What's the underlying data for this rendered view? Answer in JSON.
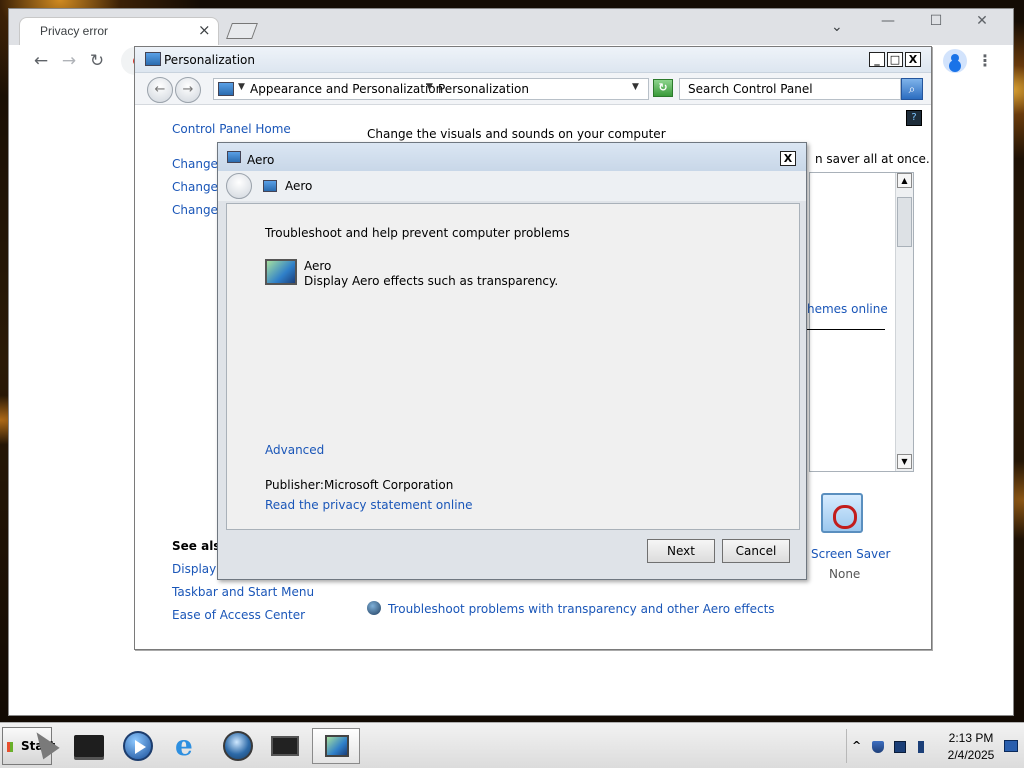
{
  "browser": {
    "tab_title": "Privacy error",
    "tab_close": "×",
    "tab_search": "⌄",
    "window_controls": {
      "minimize": "—",
      "maximize": "☐",
      "close": "✕"
    },
    "nav": {
      "back": "←",
      "forward": "→",
      "reload": "↻"
    },
    "menu": "⋮"
  },
  "control_panel": {
    "window_title": "Personalization",
    "window_controls": {
      "minimize": "_",
      "maximize": "□",
      "close": "X"
    },
    "nav": {
      "back": "←",
      "forward": "→"
    },
    "address": {
      "crumb_arrow": "▼",
      "crumbs": [
        "Appearance and Personalization",
        "Personalization"
      ]
    },
    "search_placeholder": "Search Control Panel",
    "search_icon": "search-icon",
    "help_icon_glyph": "?",
    "heading": "Change the visuals and sounds on your computer",
    "left_links": {
      "home": "Control Panel Home",
      "items": [
        "Change",
        "Change",
        "Change"
      ]
    },
    "saver_text": "n saver all at once.",
    "themes_online": "hemes online",
    "screen_saver": {
      "label": "Screen Saver",
      "value": "None"
    },
    "see_also": {
      "heading": "See also",
      "links": [
        "Display",
        "Taskbar and Start Menu",
        "Ease of Access Center"
      ]
    },
    "troubleshoot_link": "Troubleshoot problems with transparency and other Aero effects"
  },
  "aero_dialog": {
    "window_title": "Aero",
    "close": "X",
    "nav_title": "Aero",
    "heading": "Troubleshoot and help prevent computer problems",
    "item_name": "Aero",
    "item_description": "Display Aero effects such as transparency.",
    "advanced_link": "Advanced",
    "publisher_label": "Publisher:",
    "publisher_value": "Microsoft Corporation",
    "privacy_link": "Read the privacy statement online",
    "buttons": {
      "next": "Next",
      "cancel": "Cancel"
    }
  },
  "taskbar": {
    "start_label": "Start",
    "pinned_apps": [
      "terminal-icon",
      "media-player-icon",
      "internet-explorer-icon",
      "network-globe-icon",
      "remote-desktop-icon",
      "display-settings-icon"
    ],
    "tray": {
      "chevron": "^",
      "time": "2:13 PM",
      "date": "2/4/2025"
    }
  }
}
